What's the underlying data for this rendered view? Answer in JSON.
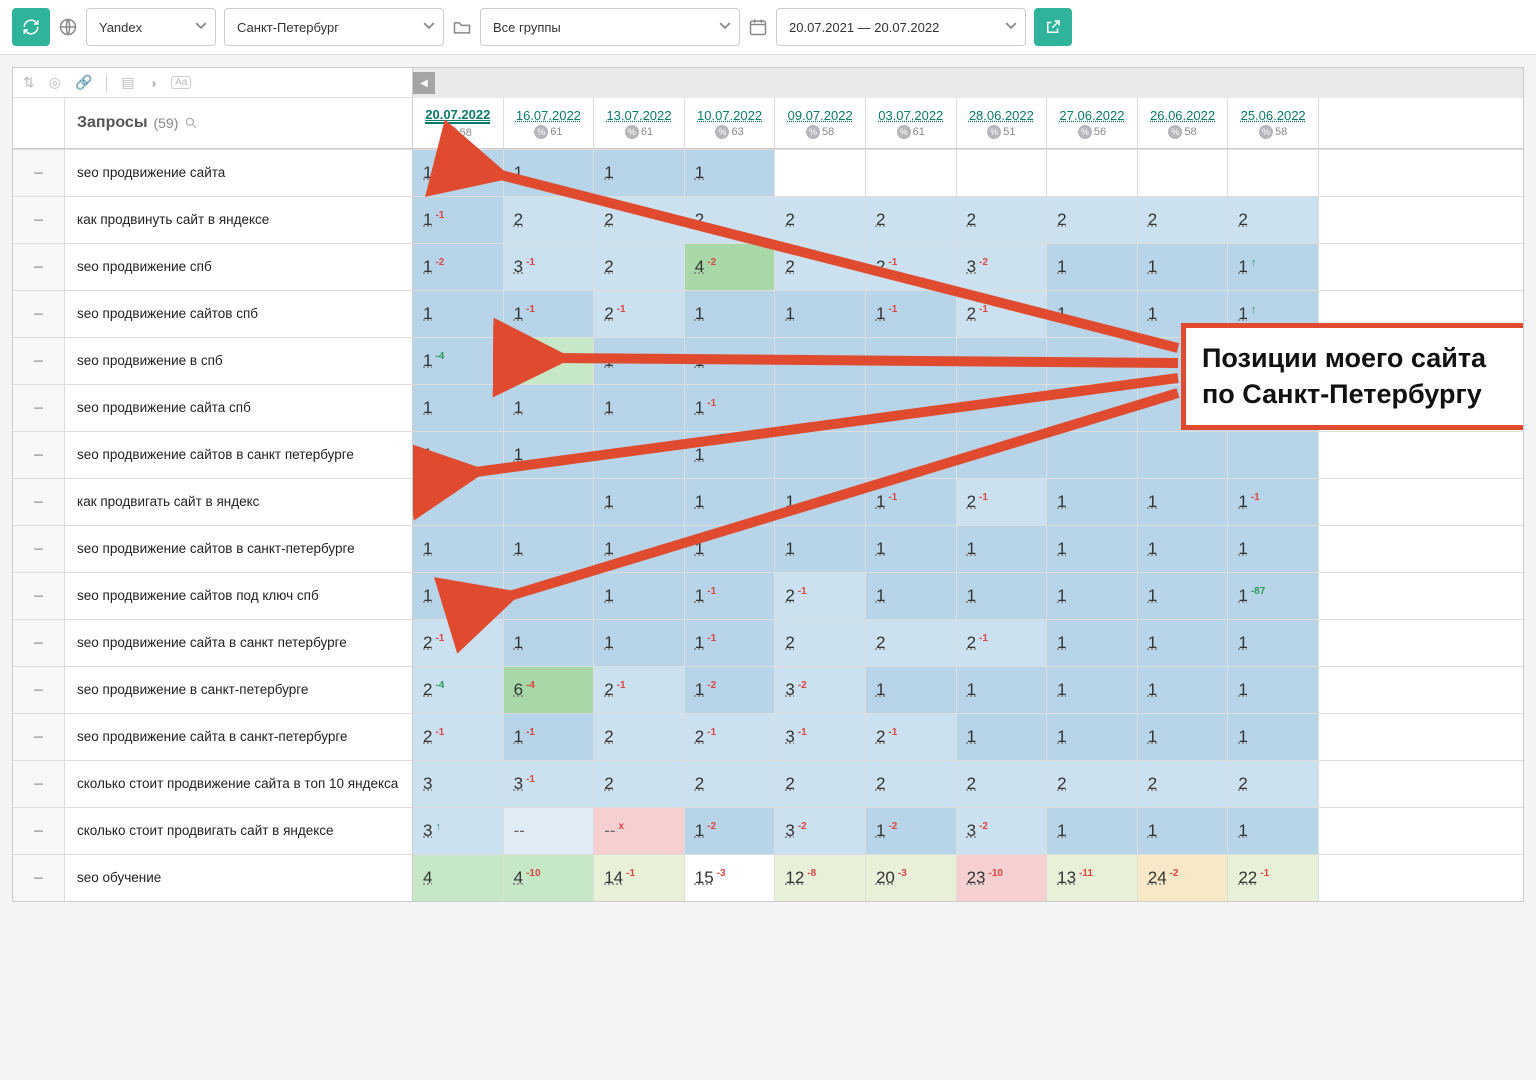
{
  "toolbar": {
    "engine": "Yandex",
    "region": "Санкт-Петербург",
    "groups": "Все группы",
    "date_range": "20.07.2021 — 20.07.2022"
  },
  "queries_header": {
    "label": "Запросы",
    "count": "(59)"
  },
  "dates": [
    {
      "d": "20.07.2022",
      "pct": "58",
      "active": true
    },
    {
      "d": "16.07.2022",
      "pct": "61"
    },
    {
      "d": "13.07.2022",
      "pct": "61"
    },
    {
      "d": "10.07.2022",
      "pct": "63"
    },
    {
      "d": "09.07.2022",
      "pct": "58"
    },
    {
      "d": "03.07.2022",
      "pct": "61"
    },
    {
      "d": "28.06.2022",
      "pct": "51"
    },
    {
      "d": "27.06.2022",
      "pct": "56"
    },
    {
      "d": "26.06.2022",
      "pct": "58"
    },
    {
      "d": "25.06.2022",
      "pct": "58"
    }
  ],
  "rows": [
    {
      "q": "seo продвижение сайта",
      "cells": [
        {
          "v": "1",
          "bg": "bg0"
        },
        {
          "v": "1",
          "bg": "bg0"
        },
        {
          "v": "1",
          "bg": "bg0"
        },
        {
          "v": "1",
          "bg": "bg0"
        },
        {
          "v": "",
          "bg": "bg5"
        },
        {
          "v": "",
          "bg": "bg5"
        },
        {
          "v": "",
          "bg": "bg5"
        },
        {
          "v": "",
          "bg": "bg5"
        },
        {
          "v": "",
          "bg": "bg5"
        },
        {
          "v": "",
          "bg": "bg5"
        }
      ]
    },
    {
      "q": "как продвинуть сайт в яндексе",
      "cells": [
        {
          "v": "1",
          "d": "-1",
          "dt": "neg",
          "bg": "bg0"
        },
        {
          "v": "2",
          "bg": "bg1"
        },
        {
          "v": "2",
          "bg": "bg1"
        },
        {
          "v": "2",
          "bg": "bg1"
        },
        {
          "v": "2",
          "bg": "bg1"
        },
        {
          "v": "2",
          "bg": "bg1"
        },
        {
          "v": "2",
          "bg": "bg1"
        },
        {
          "v": "2",
          "bg": "bg1"
        },
        {
          "v": "2",
          "bg": "bg1"
        },
        {
          "v": "2",
          "bg": "bg1"
        }
      ]
    },
    {
      "q": "seo продвижение спб",
      "cells": [
        {
          "v": "1",
          "d": "-2",
          "dt": "neg",
          "bg": "bg0"
        },
        {
          "v": "3",
          "d": "-1",
          "dt": "neg",
          "bg": "bg1"
        },
        {
          "v": "2",
          "bg": "bg1"
        },
        {
          "v": "4",
          "d": "-2",
          "dt": "neg",
          "bg": "bg2"
        },
        {
          "v": "2",
          "bg": "bg1"
        },
        {
          "v": "2",
          "d": "-1",
          "dt": "neg",
          "bg": "bg1"
        },
        {
          "v": "3",
          "d": "-2",
          "dt": "neg",
          "bg": "bg1"
        },
        {
          "v": "1",
          "bg": "bg0"
        },
        {
          "v": "1",
          "bg": "bg0"
        },
        {
          "v": "1",
          "arr": "up",
          "bg": "bg0"
        }
      ]
    },
    {
      "q": "seo продвижение сайтов спб",
      "cells": [
        {
          "v": "1",
          "bg": "bg0"
        },
        {
          "v": "1",
          "d": "-1",
          "dt": "neg",
          "bg": "bg0"
        },
        {
          "v": "2",
          "d": "-1",
          "dt": "neg",
          "bg": "bg1"
        },
        {
          "v": "1",
          "bg": "bg0"
        },
        {
          "v": "1",
          "bg": "bg0"
        },
        {
          "v": "1",
          "d": "-1",
          "dt": "neg",
          "bg": "bg0"
        },
        {
          "v": "2",
          "d": "-1",
          "dt": "neg",
          "bg": "bg1"
        },
        {
          "v": "1",
          "bg": "bg0"
        },
        {
          "v": "1",
          "bg": "bg0"
        },
        {
          "v": "1",
          "arr": "up",
          "bg": "bg0"
        }
      ]
    },
    {
      "q": "seo продвижение в спб",
      "cells": [
        {
          "v": "1",
          "d": "-4",
          "dt": "pos",
          "bg": "bg0"
        },
        {
          "v": "",
          "bg": "bg3"
        },
        {
          "v": "1",
          "bg": "bg0"
        },
        {
          "v": "1",
          "bg": "bg0"
        },
        {
          "v": "",
          "bg": "bg0"
        },
        {
          "v": "",
          "bg": "bg0"
        },
        {
          "v": "",
          "bg": "bg0"
        },
        {
          "v": "",
          "bg": "bg0"
        },
        {
          "v": "",
          "bg": "bg0"
        },
        {
          "v": "",
          "bg": "bg0"
        }
      ]
    },
    {
      "q": "seo продвижение сайта спб",
      "cells": [
        {
          "v": "1",
          "bg": "bg0"
        },
        {
          "v": "1",
          "bg": "bg0"
        },
        {
          "v": "1",
          "bg": "bg0"
        },
        {
          "v": "1",
          "d": "-1",
          "dt": "neg",
          "bg": "bg0"
        },
        {
          "v": "",
          "bg": "bg0"
        },
        {
          "v": "",
          "bg": "bg0"
        },
        {
          "v": "",
          "bg": "bg0"
        },
        {
          "v": "",
          "bg": "bg0"
        },
        {
          "v": "",
          "bg": "bg0"
        },
        {
          "v": "",
          "bg": "bg0"
        }
      ]
    },
    {
      "q": "seo продвижение сайтов в санкт петербурге",
      "cells": [
        {
          "v": "1",
          "bg": "bg0"
        },
        {
          "v": "1",
          "bg": "bg0"
        },
        {
          "v": "",
          "bg": "bg0"
        },
        {
          "v": "1",
          "bg": "bg0"
        },
        {
          "v": "",
          "bg": "bg0"
        },
        {
          "v": "",
          "bg": "bg0"
        },
        {
          "v": "",
          "bg": "bg0"
        },
        {
          "v": "",
          "bg": "bg0"
        },
        {
          "v": "",
          "bg": "bg0"
        },
        {
          "v": "",
          "bg": "bg0"
        }
      ]
    },
    {
      "q": "как продвигать сайт в яндекс",
      "cells": [
        {
          "v": "1",
          "bg": "bg0"
        },
        {
          "v": "",
          "bg": "bg0"
        },
        {
          "v": "1",
          "bg": "bg0"
        },
        {
          "v": "1",
          "bg": "bg0"
        },
        {
          "v": "1",
          "bg": "bg0"
        },
        {
          "v": "1",
          "d": "-1",
          "dt": "neg",
          "bg": "bg0"
        },
        {
          "v": "2",
          "d": "-1",
          "dt": "neg",
          "bg": "bg1"
        },
        {
          "v": "1",
          "bg": "bg0"
        },
        {
          "v": "1",
          "bg": "bg0"
        },
        {
          "v": "1",
          "d": "-1",
          "dt": "neg",
          "bg": "bg0"
        }
      ]
    },
    {
      "q": "seo продвижение сайтов в санкт-петербурге",
      "cells": [
        {
          "v": "1",
          "bg": "bg0"
        },
        {
          "v": "1",
          "bg": "bg0"
        },
        {
          "v": "1",
          "bg": "bg0"
        },
        {
          "v": "1",
          "bg": "bg0"
        },
        {
          "v": "1",
          "bg": "bg0"
        },
        {
          "v": "1",
          "bg": "bg0"
        },
        {
          "v": "1",
          "bg": "bg0"
        },
        {
          "v": "1",
          "bg": "bg0"
        },
        {
          "v": "1",
          "bg": "bg0"
        },
        {
          "v": "1",
          "bg": "bg0"
        }
      ]
    },
    {
      "q": "seo продвижение сайтов под ключ спб",
      "cells": [
        {
          "v": "1",
          "bg": "bg0"
        },
        {
          "v": "",
          "bg": "bg0"
        },
        {
          "v": "1",
          "bg": "bg0"
        },
        {
          "v": "1",
          "d": "-1",
          "dt": "neg",
          "bg": "bg0"
        },
        {
          "v": "2",
          "d": "-1",
          "dt": "neg",
          "bg": "bg1"
        },
        {
          "v": "1",
          "bg": "bg0"
        },
        {
          "v": "1",
          "bg": "bg0"
        },
        {
          "v": "1",
          "bg": "bg0"
        },
        {
          "v": "1",
          "bg": "bg0"
        },
        {
          "v": "1",
          "d": "-87",
          "dt": "pos",
          "bg": "bg0"
        }
      ]
    },
    {
      "q": "seo продвижение сайта в санкт петербурге",
      "cells": [
        {
          "v": "2",
          "d": "-1",
          "dt": "neg",
          "bg": "bg1"
        },
        {
          "v": "1",
          "bg": "bg0"
        },
        {
          "v": "1",
          "bg": "bg0"
        },
        {
          "v": "1",
          "d": "-1",
          "dt": "neg",
          "bg": "bg0"
        },
        {
          "v": "2",
          "bg": "bg1"
        },
        {
          "v": "2",
          "bg": "bg1"
        },
        {
          "v": "2",
          "d": "-1",
          "dt": "neg",
          "bg": "bg1"
        },
        {
          "v": "1",
          "bg": "bg0"
        },
        {
          "v": "1",
          "bg": "bg0"
        },
        {
          "v": "1",
          "bg": "bg0"
        }
      ]
    },
    {
      "q": "seo продвижение в санкт-петербурге",
      "cells": [
        {
          "v": "2",
          "d": "-4",
          "dt": "pos",
          "bg": "bg1"
        },
        {
          "v": "6",
          "d": "-4",
          "dt": "neg",
          "bg": "bg2"
        },
        {
          "v": "2",
          "d": "-1",
          "dt": "neg",
          "bg": "bg1"
        },
        {
          "v": "1",
          "d": "-2",
          "dt": "neg",
          "bg": "bg0"
        },
        {
          "v": "3",
          "d": "-2",
          "dt": "neg",
          "bg": "bg1"
        },
        {
          "v": "1",
          "bg": "bg0"
        },
        {
          "v": "1",
          "bg": "bg0"
        },
        {
          "v": "1",
          "bg": "bg0"
        },
        {
          "v": "1",
          "bg": "bg0"
        },
        {
          "v": "1",
          "bg": "bg0"
        }
      ]
    },
    {
      "q": "seo продвижение сайта в санкт-петербурге",
      "cells": [
        {
          "v": "2",
          "d": "-1",
          "dt": "neg",
          "bg": "bg1"
        },
        {
          "v": "1",
          "d": "-1",
          "dt": "neg",
          "bg": "bg0"
        },
        {
          "v": "2",
          "bg": "bg1"
        },
        {
          "v": "2",
          "d": "-1",
          "dt": "neg",
          "bg": "bg1"
        },
        {
          "v": "3",
          "d": "-1",
          "dt": "neg",
          "bg": "bg1"
        },
        {
          "v": "2",
          "d": "-1",
          "dt": "neg",
          "bg": "bg1"
        },
        {
          "v": "1",
          "bg": "bg0"
        },
        {
          "v": "1",
          "bg": "bg0"
        },
        {
          "v": "1",
          "bg": "bg0"
        },
        {
          "v": "1",
          "bg": "bg0"
        }
      ]
    },
    {
      "q": "сколько стоит продвижение сайта в топ 10 яндекса",
      "cells": [
        {
          "v": "3",
          "bg": "bg1"
        },
        {
          "v": "3",
          "d": "-1",
          "dt": "neg",
          "bg": "bg1"
        },
        {
          "v": "2",
          "bg": "bg1"
        },
        {
          "v": "2",
          "bg": "bg1"
        },
        {
          "v": "2",
          "bg": "bg1"
        },
        {
          "v": "2",
          "bg": "bg1"
        },
        {
          "v": "2",
          "bg": "bg1"
        },
        {
          "v": "2",
          "bg": "bg1"
        },
        {
          "v": "2",
          "bg": "bg1"
        },
        {
          "v": "2",
          "bg": "bg1"
        }
      ]
    },
    {
      "q": "сколько стоит продвигать сайт в яндексе",
      "cells": [
        {
          "v": "3",
          "arr": "up",
          "bg": "bg1"
        },
        {
          "v": "--",
          "bg": "bg7",
          "dash": true
        },
        {
          "v": "--",
          "dx": "x",
          "bg": "bg4",
          "dash": true
        },
        {
          "v": "1",
          "d": "-2",
          "dt": "neg",
          "bg": "bg0"
        },
        {
          "v": "3",
          "d": "-2",
          "dt": "neg",
          "bg": "bg1"
        },
        {
          "v": "1",
          "d": "-2",
          "dt": "neg",
          "bg": "bg0"
        },
        {
          "v": "3",
          "d": "-2",
          "dt": "neg",
          "bg": "bg1"
        },
        {
          "v": "1",
          "bg": "bg0"
        },
        {
          "v": "1",
          "bg": "bg0"
        },
        {
          "v": "1",
          "bg": "bg0"
        }
      ]
    },
    {
      "q": "seo обучение",
      "cells": [
        {
          "v": "4",
          "bg": "bg3"
        },
        {
          "v": "4",
          "d": "-10",
          "dt": "neg",
          "bg": "bg3"
        },
        {
          "v": "14",
          "d": "-1",
          "dt": "neg",
          "bg": "bg6"
        },
        {
          "v": "15",
          "d": "-3",
          "dt": "neg",
          "bg": "bg5"
        },
        {
          "v": "12",
          "d": "-8",
          "dt": "neg",
          "bg": "bg6"
        },
        {
          "v": "20",
          "d": "-3",
          "dt": "neg",
          "bg": "bg6"
        },
        {
          "v": "23",
          "d": "-10",
          "dt": "neg",
          "bg": "bg4"
        },
        {
          "v": "13",
          "d": "-11",
          "dt": "neg",
          "bg": "bg6"
        },
        {
          "v": "24",
          "d": "-2",
          "dt": "neg",
          "bg": "bg8"
        },
        {
          "v": "22",
          "d": "-1",
          "dt": "neg",
          "bg": "bg6"
        }
      ]
    }
  ],
  "annotation": {
    "line1": "Позиции моего сайта",
    "line2": "по Санкт-Петербургу"
  }
}
